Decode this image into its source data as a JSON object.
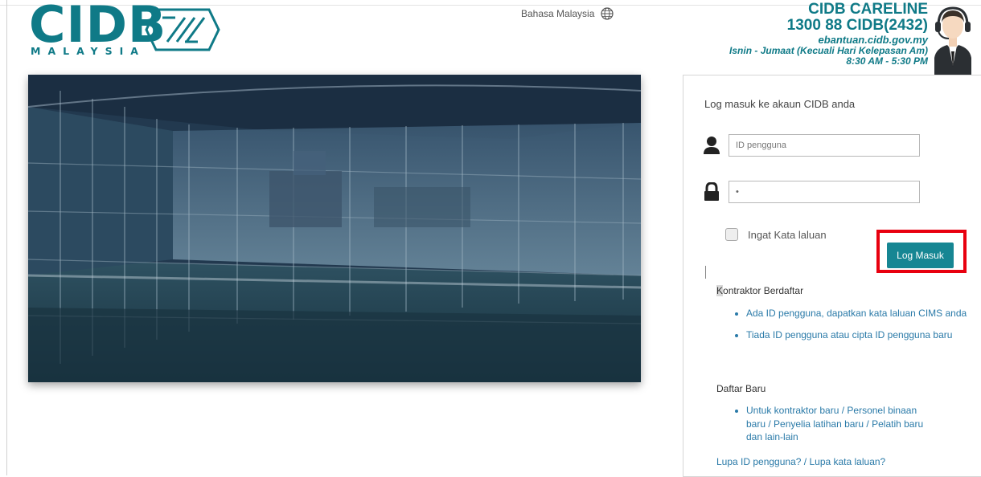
{
  "brand": {
    "logo_text": "CIDB",
    "logo_sub": "MALAYSIA",
    "accent": "#0f7a87"
  },
  "header": {
    "language_label": "Bahasa Malaysia",
    "language_icon": "globe-icon"
  },
  "careline": {
    "title": "CIDB CARELINE",
    "phone": "1300 88 CIDB(2432)",
    "url": "ebantuan.cidb.gov.my",
    "days": "Isnin - Jumaat (Kecuali Hari Kelepasan Am)",
    "hours": "8:30 AM - 5:30 PM",
    "agent_icon": "headset-agent-icon"
  },
  "login": {
    "title": "Log masuk ke akaun CIDB anda",
    "username_placeholder": "ID pengguna",
    "username_value": "",
    "password_value": "•",
    "remember_label": "Ingat Kata laluan",
    "submit_label": "Log Masuk",
    "button_color": "#168693",
    "highlight_color": "#e8000f"
  },
  "registered": {
    "title_first": "K",
    "title_rest": "ontraktor Berdaftar",
    "links": [
      "Ada ID pengguna, dapatkan kata laluan CIMS anda",
      "Tiada ID pengguna atau cipta ID pengguna baru"
    ]
  },
  "new_registration": {
    "title": "Daftar Baru",
    "links": [
      "Untuk kontraktor baru / Personel binaan baru / Penyelia latihan baru / Pelatih baru dan lain-lain"
    ]
  },
  "forgot": {
    "user_id": "Lupa ID pengguna?",
    "separator": "/",
    "password": "Lupa kata laluan?"
  }
}
